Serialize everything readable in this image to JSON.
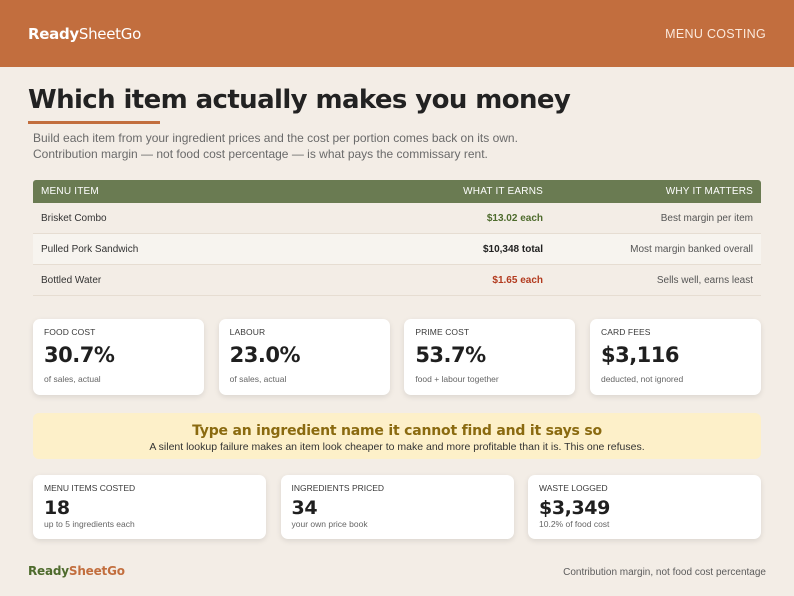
{
  "brand": {
    "part1": "Ready",
    "part2": "SheetGo"
  },
  "header": {
    "nav": "MENU COSTING"
  },
  "page": {
    "title": "Which item actually makes you money",
    "intro": "Build each item from your ingredient prices and the cost per portion comes back on its own. Contribution margin — not food cost percentage — is what pays the commissary rent."
  },
  "table": {
    "headers": [
      "MENU ITEM",
      "WHAT IT EARNS",
      "WHY IT MATTERS"
    ],
    "rows": [
      {
        "item": "Brisket Combo",
        "earns": "$13.02 each",
        "why": "Best margin per item"
      },
      {
        "item": "Pulled Pork Sandwich",
        "earns": "$10,348 total",
        "why": "Most margin banked overall"
      },
      {
        "item": "Bottled Water",
        "earns": "$1.65 each",
        "why": "Sells well, earns least"
      }
    ]
  },
  "kpis": [
    {
      "label": "FOOD COST",
      "value": "30.7%",
      "sub": "of sales, actual"
    },
    {
      "label": "LABOUR",
      "value": "23.0%",
      "sub": "of sales, actual"
    },
    {
      "label": "PRIME COST",
      "value": "53.7%",
      "sub": "food + labour together"
    },
    {
      "label": "CARD FEES",
      "value": "$3,116",
      "sub": "deducted, not ignored"
    }
  ],
  "banner": {
    "title": "Type an ingredient name it cannot find and it says so",
    "text": "A silent lookup failure makes an item look cheaper to make and more profitable than it is. This one refuses."
  },
  "stats": [
    {
      "label": "MENU ITEMS COSTED",
      "value": "18",
      "sub": "up to 5 ingredients each"
    },
    {
      "label": "INGREDIENTS PRICED",
      "value": "34",
      "sub": "your own price book"
    },
    {
      "label": "WASTE LOGGED",
      "value": "$3,349",
      "sub": "10.2% of food cost"
    }
  ],
  "footer": {
    "note": "Contribution margin, not food cost percentage"
  },
  "colors": {
    "accent": "#c26e3e",
    "table_header": "#6a7b52",
    "positive": "#4e6b2d",
    "negative": "#b23a1e",
    "banner": "#fdf0c9"
  }
}
